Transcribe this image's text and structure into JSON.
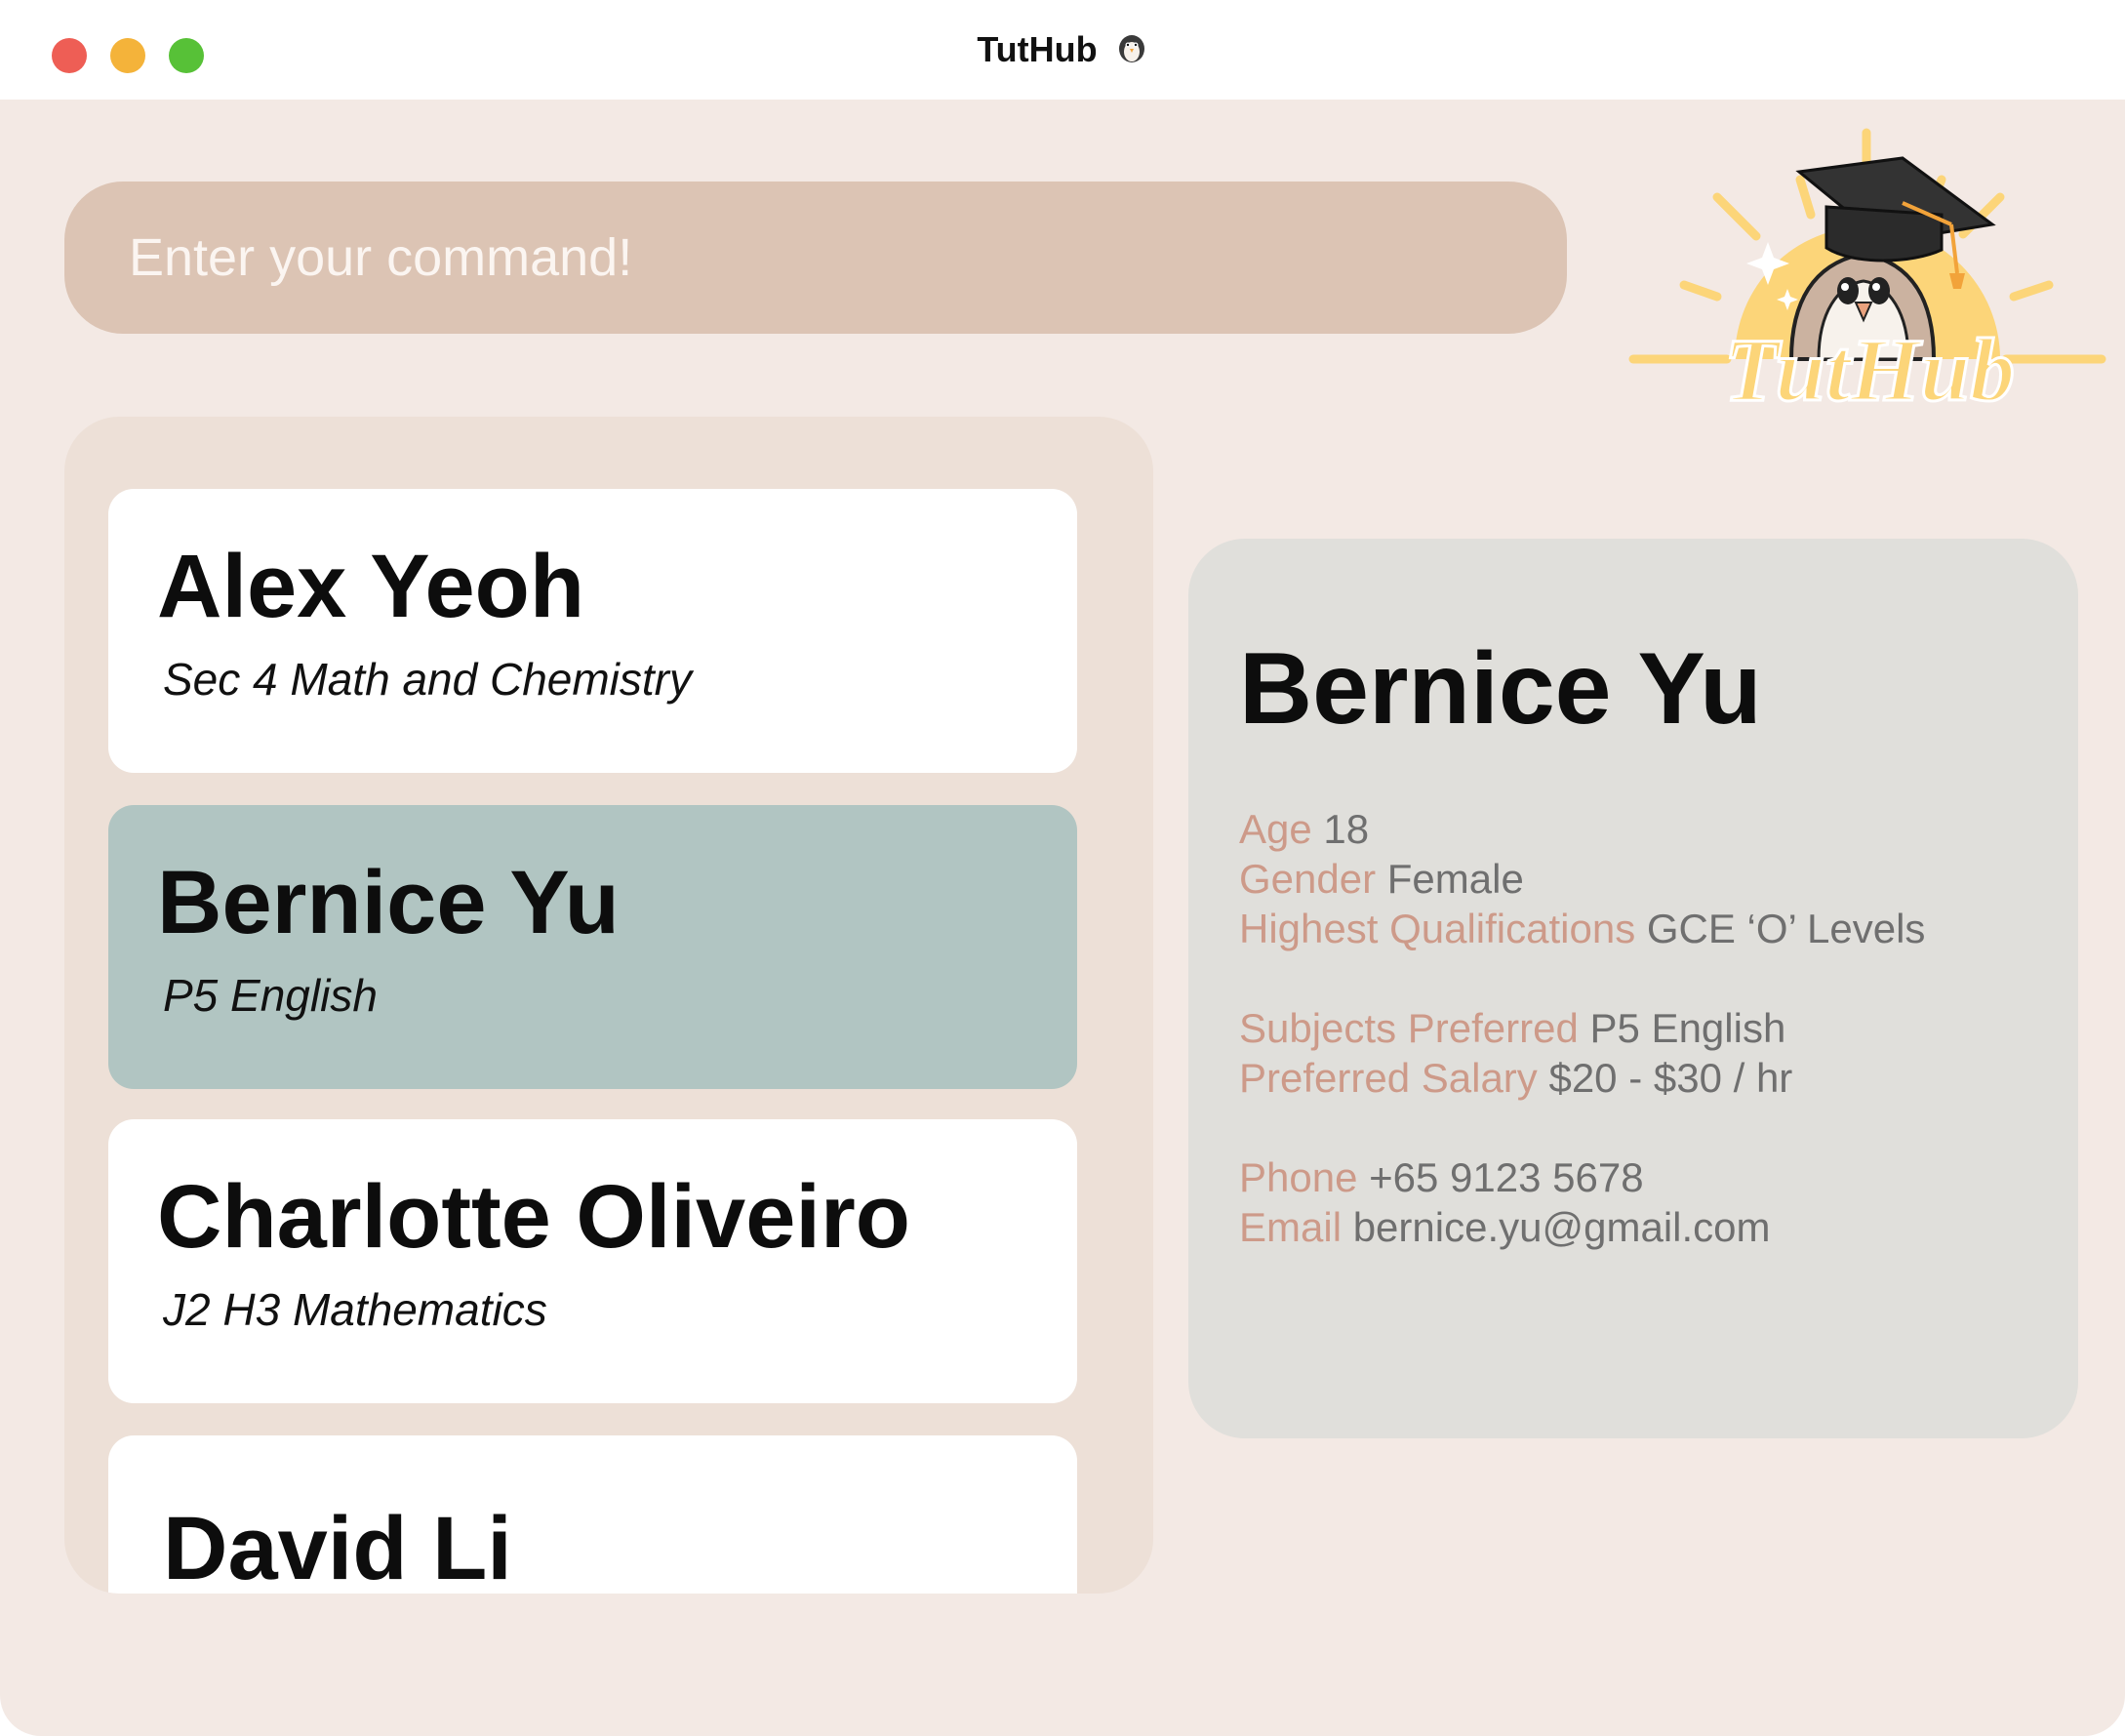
{
  "window": {
    "title": "TutHub"
  },
  "command": {
    "placeholder": "Enter your command!"
  },
  "logo": {
    "text": "TutHub"
  },
  "tutors": [
    {
      "name": "Alex Yeoh",
      "subjects": "Sec 4 Math and Chemistry",
      "selected": false
    },
    {
      "name": "Bernice Yu",
      "subjects": "P5 English",
      "selected": true
    },
    {
      "name": "Charlotte Oliveiro",
      "subjects": "J2 H3 Mathematics",
      "selected": false
    },
    {
      "name": "David Li",
      "subjects": "",
      "selected": false
    }
  ],
  "detail": {
    "name": "Bernice Yu",
    "age_label": "Age",
    "age": "18",
    "gender_label": "Gender",
    "gender": "Female",
    "qualifications_label": "Highest Qualifications",
    "qualifications": "GCE ‘O’ Levels",
    "subjects_label": "Subjects Preferred",
    "subjects": "P5 English",
    "salary_label": "Preferred Salary",
    "salary": "$20 - $30 / hr",
    "phone_label": "Phone",
    "phone": "+65 9123 5678",
    "email_label": "Email",
    "email": "bernice.yu@gmail.com"
  },
  "colors": {
    "background": "#f3e9e4",
    "command_bar": "#dcc4b4",
    "list_panel": "#ede0d7",
    "selected_card": "#b1c5c2",
    "detail_panel": "#e0dfdb",
    "label": "#cd9a89",
    "value": "#6f6f6f",
    "logo_sun": "#fcd579"
  },
  "icons": {
    "title_icon": "penguin-icon",
    "logo_icon": "penguin-graduate-icon"
  }
}
